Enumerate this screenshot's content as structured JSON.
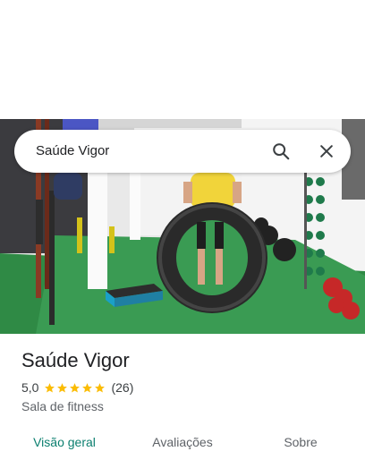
{
  "search": {
    "query": "Saúde Vigor",
    "search_icon": "search-icon",
    "clear_icon": "close-icon"
  },
  "place": {
    "name": "Saúde Vigor",
    "rating": "5,0",
    "stars": 5,
    "review_count": "(26)",
    "category": "Sala de fitness"
  },
  "tabs": [
    {
      "label": "Visão geral",
      "active": true
    },
    {
      "label": "Avaliações",
      "active": false
    },
    {
      "label": "Sobre",
      "active": false
    }
  ],
  "colors": {
    "accent": "#0b7f6f",
    "star": "#fbbc04"
  }
}
